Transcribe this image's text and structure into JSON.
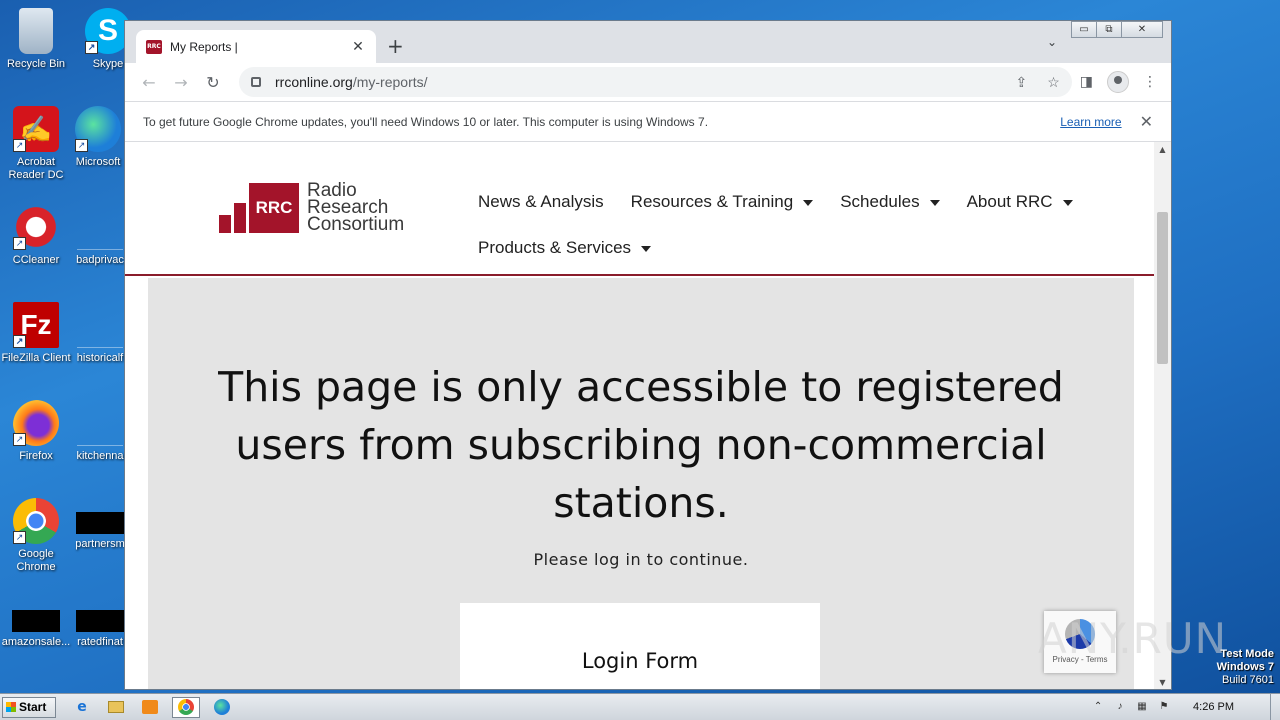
{
  "desktop": {
    "icons": [
      {
        "label": "Recycle Bin",
        "icon": "recycle-bin-icon"
      },
      {
        "label": "Skype",
        "icon": "skype-icon"
      },
      {
        "label": "Acrobat Reader DC",
        "icon": "acrobat-icon"
      },
      {
        "label": "Microsoft",
        "icon": "edge-icon"
      },
      {
        "label": "CCleaner",
        "icon": "ccleaner-icon"
      },
      {
        "label": "badprivac",
        "icon": "file-icon"
      },
      {
        "label": "FileZilla Client",
        "icon": "filezilla-icon"
      },
      {
        "label": "historicalf",
        "icon": "file-icon"
      },
      {
        "label": "Firefox",
        "icon": "firefox-icon"
      },
      {
        "label": "kitchenna",
        "icon": "file-icon"
      },
      {
        "label": "Google Chrome",
        "icon": "chrome-icon"
      },
      {
        "label": "partnersm",
        "icon": "file-icon"
      },
      {
        "label": "amazonsale...",
        "icon": "file-icon"
      },
      {
        "label": "ratedfinat",
        "icon": "file-icon"
      }
    ]
  },
  "browser": {
    "tab_title": "My Reports |",
    "favicon_text": "RRC",
    "tab_close": "✕",
    "new_tab": "+",
    "tab_search": "⌄",
    "win_minimize": "▭",
    "win_restore": "⧉",
    "win_close": "✕",
    "url_host": "rrconline.org",
    "url_path": "/my-reports/",
    "infobar_text": "To get future Google Chrome updates, you'll need Windows 10 or later. This computer is using Windows 7.",
    "infobar_link": "Learn more",
    "infobar_close": "✕"
  },
  "site": {
    "logo_box": "RRC",
    "logo_line1": "Radio",
    "logo_line2": "Research",
    "logo_line3": "Consortium",
    "nav": {
      "news": "News & Analysis",
      "resources": "Resources & Training",
      "schedules": "Schedules",
      "about": "About RRC",
      "products": "Products & Services"
    },
    "headline": "This page is only accessible to registered users from subscribing non-commercial stations.",
    "subline": "Please log in to continue.",
    "login_title": "Login Form",
    "recaptcha_text": "Privacy - Terms"
  },
  "overlay": {
    "watermark": "ANY.RUN",
    "test_mode": "Test Mode",
    "windows": "Windows 7",
    "build": "Build 7601"
  },
  "taskbar": {
    "start": "Start",
    "clock": "4:26 PM"
  }
}
